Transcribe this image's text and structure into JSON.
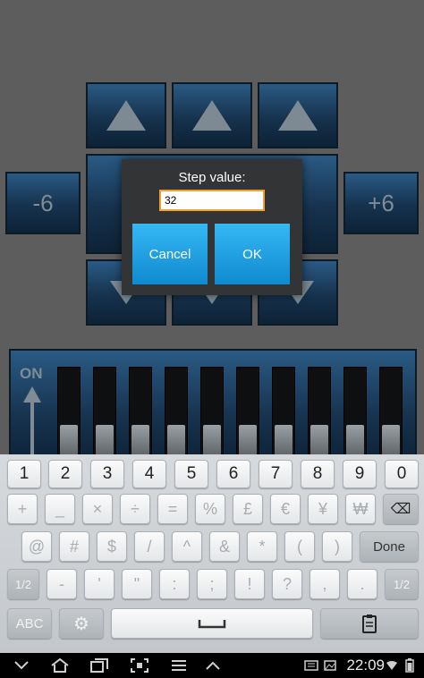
{
  "app": {
    "step_minus_label": "-6",
    "step_plus_label": "+6",
    "fader_panel_label": "ON"
  },
  "dialog": {
    "title": "Step value:",
    "input_value": "32",
    "cancel_label": "Cancel",
    "ok_label": "OK"
  },
  "keyboard": {
    "row1": [
      "1",
      "2",
      "3",
      "4",
      "5",
      "6",
      "7",
      "8",
      "9",
      "0"
    ],
    "row2": [
      "+",
      "_",
      "×",
      "÷",
      "=",
      "%",
      "£",
      "€",
      "¥",
      "₩"
    ],
    "row3": [
      "@",
      "#",
      "$",
      "/",
      "^",
      "&",
      "*",
      "(",
      ")"
    ],
    "done_label": "Done",
    "row4": [
      "1/2",
      "-",
      "'",
      "\"",
      ":",
      ";",
      "!",
      "?",
      ",",
      "."
    ],
    "row4_right": "1/2",
    "abc_label": "ABC",
    "icons": {
      "backspace": "backspace-icon",
      "settings": "gear-icon",
      "space": "space-bar-icon",
      "clipboard": "clipboard-icon"
    }
  },
  "statusbar": {
    "time": "22:09"
  },
  "colors": {
    "tile_blue": "#1e4568",
    "dialog_button": "#1ea4e6",
    "input_focus": "#f0a030"
  }
}
